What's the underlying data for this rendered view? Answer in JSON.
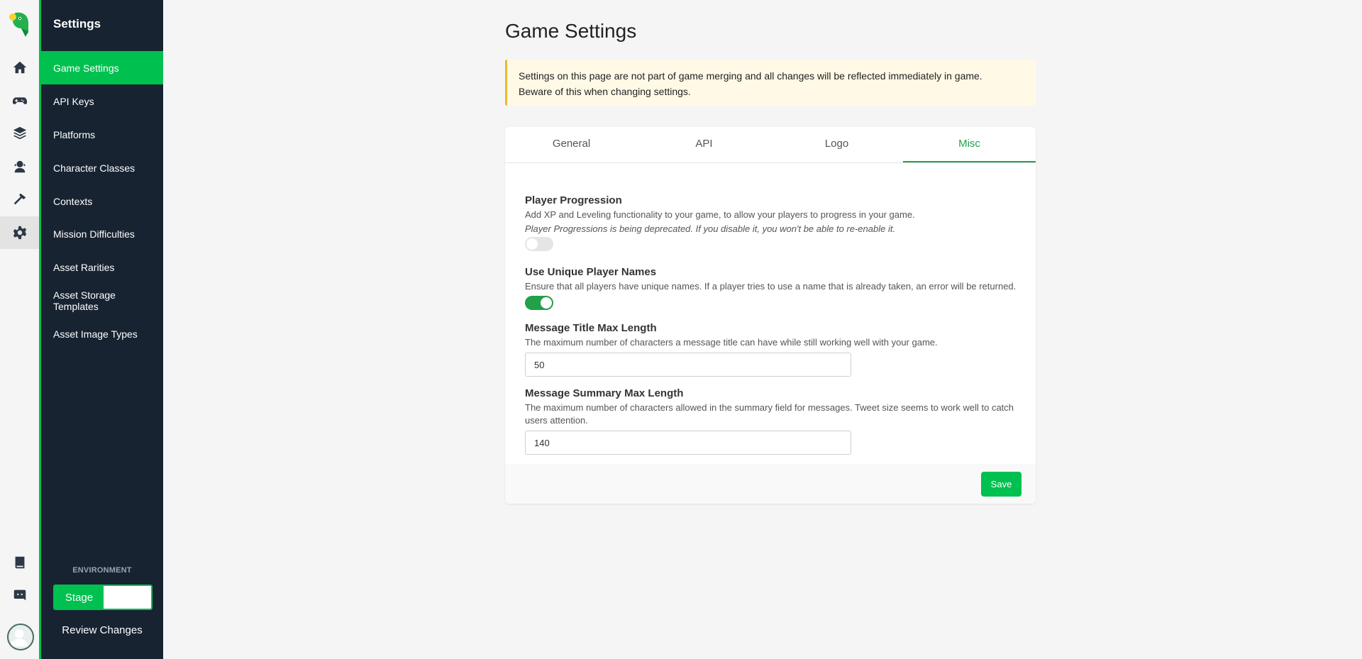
{
  "sidebar": {
    "title": "Settings",
    "items": [
      {
        "label": "Game Settings",
        "active": true
      },
      {
        "label": "API Keys"
      },
      {
        "label": "Platforms"
      },
      {
        "label": "Character Classes"
      },
      {
        "label": "Contexts"
      },
      {
        "label": "Mission Difficulties"
      },
      {
        "label": "Asset Rarities"
      },
      {
        "label": "Asset Storage Templates"
      },
      {
        "label": "Asset Image Types"
      }
    ],
    "environment_label": "ENVIRONMENT",
    "environment_value": "Stage",
    "review_changes": "Review Changes"
  },
  "rail": {
    "icons": [
      "home-icon",
      "gamepad-icon",
      "layers-icon",
      "player-icon",
      "hammer-icon",
      "gear-icon",
      "book-icon",
      "discord-icon"
    ],
    "active": "gear-icon"
  },
  "page": {
    "title": "Game Settings",
    "notice": "Settings on this page are not part of game merging and all changes will be reflected immediately in game.",
    "notice_line2": "Beware of this when changing settings."
  },
  "tabs": [
    {
      "label": "General"
    },
    {
      "label": "API"
    },
    {
      "label": "Logo"
    },
    {
      "label": "Misc",
      "active": true
    }
  ],
  "fields": {
    "player_progression": {
      "label": "Player Progression",
      "desc": "Add XP and Leveling functionality to your game, to allow your players to progress in your game.",
      "note": "Player Progressions is being deprecated. If you disable it, you won't be able to re-enable it.",
      "enabled": false
    },
    "unique_names": {
      "label": "Use Unique Player Names",
      "desc": "Ensure that all players have unique names. If a player tries to use a name that is already taken, an error will be returned.",
      "enabled": true
    },
    "title_max": {
      "label": "Message Title Max Length",
      "desc": "The maximum number of characters a message title can have while still working well with your game.",
      "value": "50"
    },
    "summary_max": {
      "label": "Message Summary Max Length",
      "desc": "The maximum number of characters allowed in the summary field for messages. Tweet size seems to work well to catch users attention.",
      "value": "140"
    }
  },
  "save_label": "Save",
  "colors": {
    "accent": "#00c050",
    "sidebar_bg": "#172331",
    "tab_active": "#22a04a"
  }
}
